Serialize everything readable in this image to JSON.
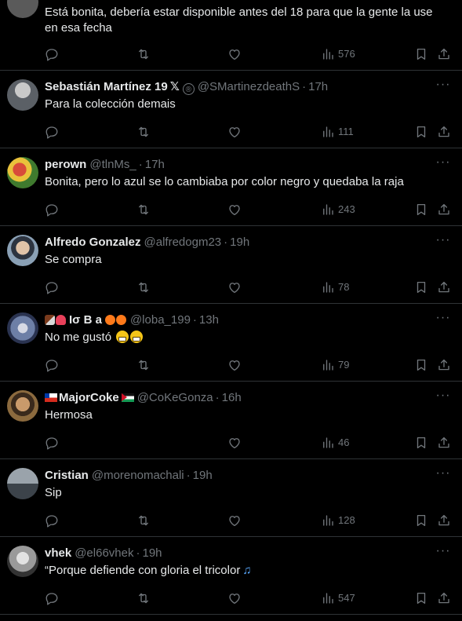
{
  "tweets": [
    {
      "avatar_color": "#5a5a5a",
      "text": "Está bonita, debería estar disponible antes del 18 para que la gente la use en esa fecha",
      "views": "576"
    },
    {
      "name": "Sebastián Martínez 19",
      "name_badge": "𝕏",
      "handle_badge": "®",
      "handle": "@SMartinezdeathS",
      "time": "17h",
      "text": "Para la colección demais",
      "views": "111",
      "avatar_color": "#8a8f96"
    },
    {
      "name": "perown",
      "handle": "@tlnMs_",
      "time": "17h",
      "text": "Bonita, pero lo azul se lo cambiaba por color negro y quedaba la raja",
      "views": "243",
      "avatar_color": "#3f7a2e"
    },
    {
      "name": "Alfredo Gonzalez",
      "handle": "@alfredogm23",
      "time": "19h",
      "text": "Se compra",
      "views": "78",
      "avatar_color": "#7d8794"
    },
    {
      "name": "Iσ B a",
      "handle": "@loba_199",
      "time": "13h",
      "text": "No me gustó",
      "views": "79",
      "avatar_color": "#6d7fa6"
    },
    {
      "name": "MajorCoke",
      "handle": "@CoKeGonza",
      "time": "16h",
      "text": "Hermosa",
      "views": "46",
      "avatar_color": "#8b6a3e"
    },
    {
      "name": "Cristian",
      "handle": "@morenomachali",
      "time": "19h",
      "text": "Sip",
      "views": "128",
      "avatar_color": "#6b7680"
    },
    {
      "name": "vhek",
      "handle": "@el66vhek",
      "time": "19h",
      "text": "“Porque defiende con gloria el tricolor",
      "views": "547",
      "avatar_color": "#9a9a9a"
    }
  ],
  "ui": {
    "more_glyph": "···",
    "dot": "·",
    "music_glyph": "♫"
  },
  "icons": {
    "reply": "reply-icon",
    "retweet": "retweet-icon",
    "like": "heart-icon",
    "views": "views-icon",
    "bookmark": "bookmark-icon",
    "share": "share-icon"
  }
}
